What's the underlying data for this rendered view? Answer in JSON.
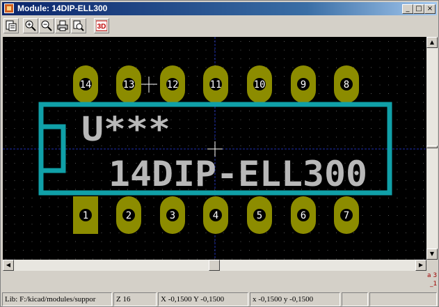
{
  "window": {
    "title": "Module: 14DIP-ELL300",
    "controls": {
      "minimize": "_",
      "maximize": "□",
      "close": "×"
    }
  },
  "toolbar": {
    "items": [
      {
        "name": "module-select",
        "icon": "module-icon"
      },
      {
        "name": "zoom-in",
        "icon": "zoom-in-icon"
      },
      {
        "name": "zoom-out",
        "icon": "zoom-out-icon"
      },
      {
        "name": "print",
        "icon": "print-icon"
      },
      {
        "name": "zoom-fit",
        "icon": "zoom-fit-icon"
      },
      {
        "name": "view-3d",
        "icon": "3d-icon",
        "label": "3D"
      }
    ]
  },
  "footprint": {
    "reference": "U***",
    "value": "14DIP-ELL300",
    "pads_top": [
      "14",
      "13",
      "12",
      "11",
      "10",
      "9",
      "8"
    ],
    "pads_bottom": [
      "1",
      "2",
      "3",
      "4",
      "5",
      "6",
      "7"
    ],
    "colors": {
      "background": "#000000",
      "silkscreen": "#10a0a8",
      "pad": "#8c8c00",
      "text": "#c0c0c0",
      "grid": "#5a5a5a",
      "axis": "#2030b0"
    }
  },
  "status": {
    "lib": "Lib: F:/kicad/modules/suppor",
    "zoom": "Z 16",
    "abs_coords": "X -0,1500  Y -0,1500",
    "rel_coords": "x -0,1500  y -0,1500",
    "empty1": "",
    "empty2": ""
  },
  "side_marks": {
    "top": "a 3",
    "bottom": "_1"
  }
}
